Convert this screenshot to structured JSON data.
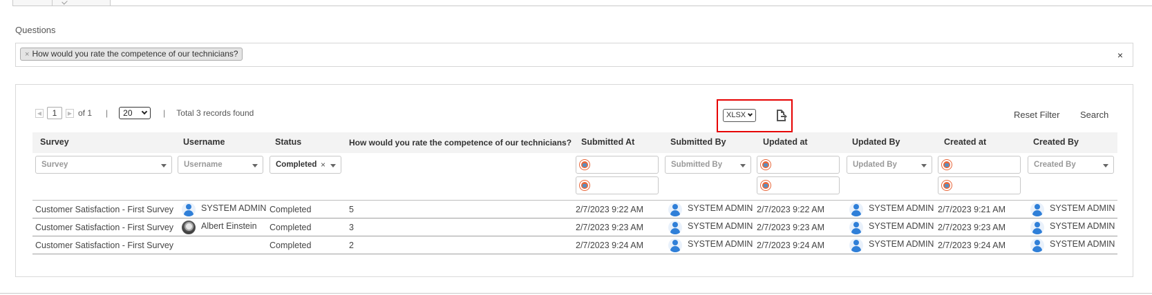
{
  "questions": {
    "label": "Questions",
    "selected_tag": "How would you rate the competence of our technicians?",
    "tag_remove": "×",
    "clear": "×"
  },
  "pager": {
    "page": "1",
    "of_label": "of 1",
    "separator": "|",
    "page_size": "20",
    "total": "Total 3 records found"
  },
  "export": {
    "format": "XLSX",
    "icon": "export-file-icon"
  },
  "actions": {
    "reset": "Reset Filter",
    "search": "Search"
  },
  "columns": [
    "Survey",
    "Username",
    "Status",
    "How would you rate the competence of our technicians?",
    "Submitted At",
    "Submitted By",
    "Updated at",
    "Updated By",
    "Created at",
    "Created By"
  ],
  "filters": {
    "survey": "Survey",
    "username": "Username",
    "status": "Completed",
    "status_clear": "×",
    "submitted_by": "Submitted By",
    "updated_by": "Updated By",
    "created_by": "Created By"
  },
  "rows": [
    {
      "survey": "Customer Satisfaction - First Survey",
      "username": "SYSTEM ADMIN",
      "status": "Completed",
      "answer": "5",
      "submitted_at": "2/7/2023 9:22 AM",
      "submitted_by": "SYSTEM ADMIN",
      "updated_at": "2/7/2023 9:22 AM",
      "updated_by": "SYSTEM ADMIN",
      "created_at": "2/7/2023 9:21 AM",
      "created_by": "SYSTEM ADMIN"
    },
    {
      "survey": "Customer Satisfaction - First Survey",
      "username": "Albert Einstein",
      "status": "Completed",
      "answer": "3",
      "submitted_at": "2/7/2023 9:23 AM",
      "submitted_by": "SYSTEM ADMIN",
      "updated_at": "2/7/2023 9:23 AM",
      "updated_by": "SYSTEM ADMIN",
      "created_at": "2/7/2023 9:23 AM",
      "created_by": "SYSTEM ADMIN"
    },
    {
      "survey": "Customer Satisfaction - First Survey",
      "username": "",
      "status": "Completed",
      "answer": "2",
      "submitted_at": "2/7/2023 9:24 AM",
      "submitted_by": "SYSTEM ADMIN",
      "updated_at": "2/7/2023 9:24 AM",
      "updated_by": "SYSTEM ADMIN",
      "created_at": "2/7/2023 9:24 AM",
      "created_by": "SYSTEM ADMIN"
    }
  ]
}
